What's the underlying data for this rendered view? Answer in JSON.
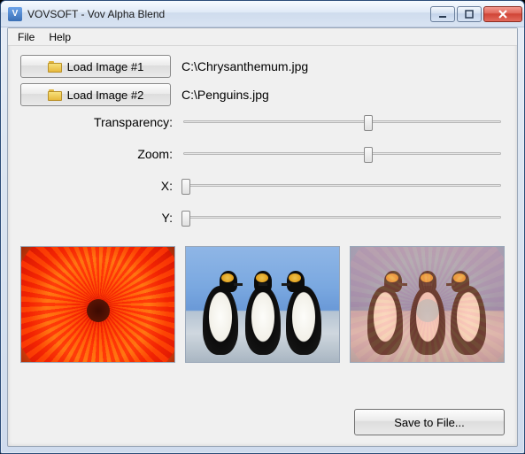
{
  "window": {
    "title": "VOVSOFT - Vov Alpha Blend"
  },
  "menu": {
    "file": "File",
    "help": "Help"
  },
  "buttons": {
    "load1": "Load Image #1",
    "load2": "Load Image #2",
    "save": "Save to File..."
  },
  "paths": {
    "image1": "C:\\Chrysanthemum.jpg",
    "image2": "C:\\Penguins.jpg"
  },
  "labels": {
    "transparency": "Transparency:",
    "zoom": "Zoom:",
    "x": "X:",
    "y": "Y:"
  },
  "sliders": {
    "transparency": {
      "pos_percent": 58
    },
    "zoom": {
      "pos_percent": 58
    },
    "x": {
      "pos_percent": 2
    },
    "y": {
      "pos_percent": 2
    }
  },
  "icons": {
    "app": "V",
    "folder": "folder-icon"
  }
}
